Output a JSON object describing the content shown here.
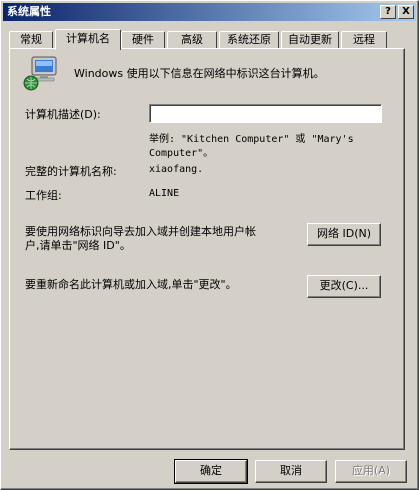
{
  "window": {
    "title": "系统属性",
    "help_btn": "?",
    "close_btn": "X"
  },
  "tabs": [
    {
      "label": "常规",
      "active": false
    },
    {
      "label": "计算机名",
      "active": true
    },
    {
      "label": "硬件",
      "active": false
    },
    {
      "label": "高级",
      "active": false
    },
    {
      "label": "系统还原",
      "active": false
    },
    {
      "label": "自动更新",
      "active": false
    },
    {
      "label": "远程",
      "active": false
    }
  ],
  "computer_name_tab": {
    "intro_text": "Windows 使用以下信息在网络中标识这台计算机。",
    "description_label": "计算机描述(D):",
    "description_value": "",
    "example_line1": "举例: \"Kitchen Computer\" 或 \"Mary's",
    "example_line2": "Computer\"。",
    "full_name_label": "完整的计算机名称:",
    "full_name_value": "xiaofang.",
    "workgroup_label": "工作组:",
    "workgroup_value": "ALINE",
    "network_id_text_line1": "要使用网络标识向导去加入域并创建本地用户帐",
    "network_id_text_line2": "户,请单击\"网络 ID\"。",
    "network_id_button": "网络 ID(N)",
    "rename_text": "要重新命名此计算机或加入域,单击\"更改\"。",
    "change_button": "更改(C)..."
  },
  "footer": {
    "ok_button": "确定",
    "cancel_button": "取消",
    "apply_button": "应用(A)"
  },
  "colors": {
    "face": "#d4d0c8",
    "title_start": "#0a246a",
    "title_end": "#a6caf0"
  }
}
